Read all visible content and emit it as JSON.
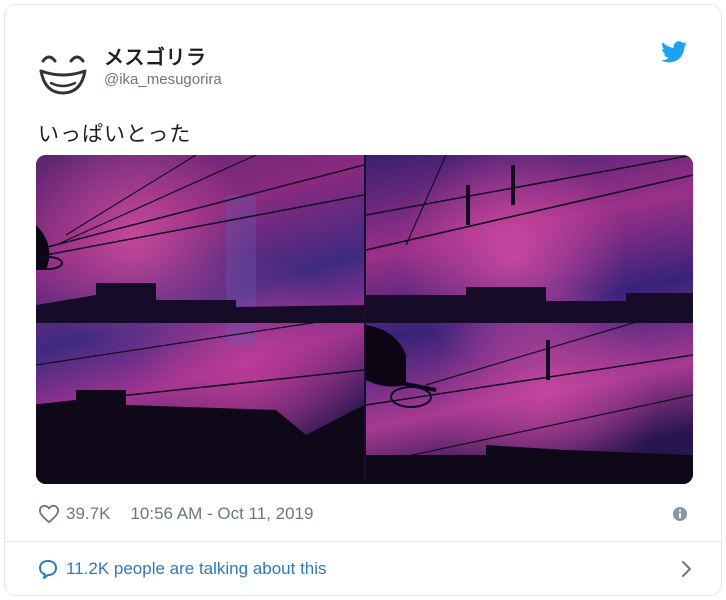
{
  "user": {
    "display_name": "メスゴリラ",
    "handle": "@ika_mesugorira"
  },
  "tweet": {
    "text": "いっぱいとった",
    "likes": "39.7K",
    "timestamp": "10:56 AM - Oct 11, 2019"
  },
  "footer": {
    "talking_text": "11.2K people are talking about this"
  },
  "colors": {
    "twitter_blue": "#1da1f2",
    "link_blue": "#2b7bb9",
    "muted_gray": "#697882"
  },
  "icons": [
    "avatar-face-icon",
    "twitter-bird-icon",
    "heart-icon",
    "info-icon",
    "speech-bubble-icon",
    "chevron-right-icon"
  ]
}
